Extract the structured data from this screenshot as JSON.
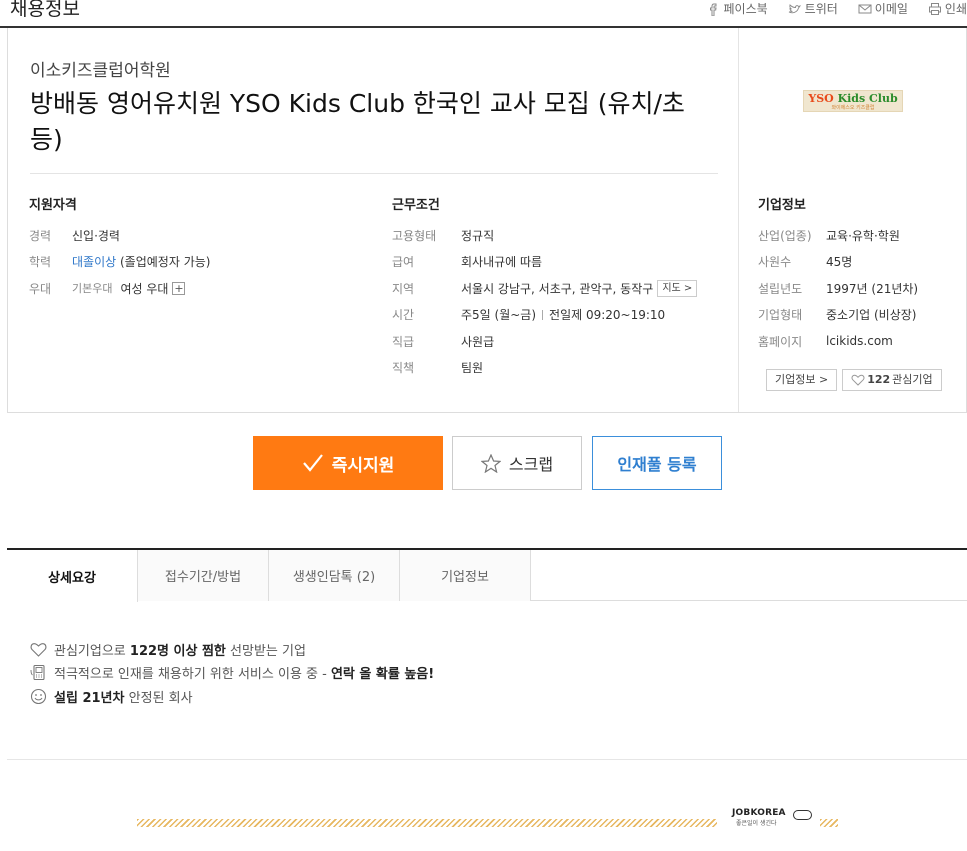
{
  "header": {
    "title": "채용정보",
    "share": [
      {
        "label": "페이스북",
        "icon": "facebook-icon"
      },
      {
        "label": "트위터",
        "icon": "twitter-icon"
      },
      {
        "label": "이메일",
        "icon": "email-icon"
      },
      {
        "label": "인쇄",
        "icon": "print-icon"
      }
    ]
  },
  "job": {
    "company": "이소키즈클럽어학원",
    "title": "방배동 영어유치원 YSO Kids Club 한국인 교사 모집 (유치/초등)"
  },
  "logo": {
    "text_y": "YSO",
    "text_rest": " Kids Club",
    "sub": "와이에스오 키즈클럽"
  },
  "qualifications": {
    "heading": "지원자격",
    "experience_label": "경력",
    "experience_value": "신입·경력",
    "education_label": "학력",
    "education_value": "대졸이상",
    "education_note": "(졸업예정자 가능)",
    "preference_label": "우대",
    "preference_sub": "기본우대",
    "preference_value": "여성 우대",
    "preference_more": "+"
  },
  "conditions": {
    "heading": "근무조건",
    "type_label": "고용형태",
    "type_value": "정규직",
    "salary_label": "급여",
    "salary_value": "회사내규에 따름",
    "region_label": "지역",
    "region_value": "서울시 강남구, 서초구, 관악구, 동작구",
    "map_label": "지도 >",
    "time_label": "시간",
    "time_value1": "주5일 (월~금)",
    "time_value2": "전일제 09:20~19:10",
    "rank_label": "직급",
    "rank_value": "사원급",
    "position_label": "직책",
    "position_value": "팀원"
  },
  "company_info": {
    "heading": "기업정보",
    "industry_label": "산업(업종)",
    "industry_value": "교육·유학·학원",
    "employees_label": "사원수",
    "employees_value": "45명",
    "founded_label": "설립년도",
    "founded_value": "1997년 (21년차)",
    "form_label": "기업형태",
    "form_value": "중소기업 (비상장)",
    "homepage_label": "홈페이지",
    "homepage_value": "lcikids.com",
    "info_button": "기업정보 >",
    "interest_count": "122",
    "interest_label": "관심기업"
  },
  "actions": {
    "apply": "즉시지원",
    "scrap": "스크랩",
    "pool": "인재풀 등록"
  },
  "tabs": [
    {
      "label": "상세요강",
      "active": true
    },
    {
      "label": "접수기간/방법",
      "active": false
    },
    {
      "label": "생생인담톡 (2)",
      "active": false
    },
    {
      "label": "기업정보",
      "active": false
    }
  ],
  "features": {
    "f1_pre": "관심기업으로",
    "f1_bold": "122명 이상 찜한",
    "f1_post": "선망받는 기업",
    "f2_pre": "적극적으로 인재를 채용하기 위한 서비스 이용 중 -",
    "f2_bold": "연락 올 확률 높음!",
    "f3_bold": "설립 21년차",
    "f3_post": "안정된 회사"
  },
  "footer": {
    "brand": "JOBKOREA",
    "tagline": "좋은일이 생긴다"
  }
}
